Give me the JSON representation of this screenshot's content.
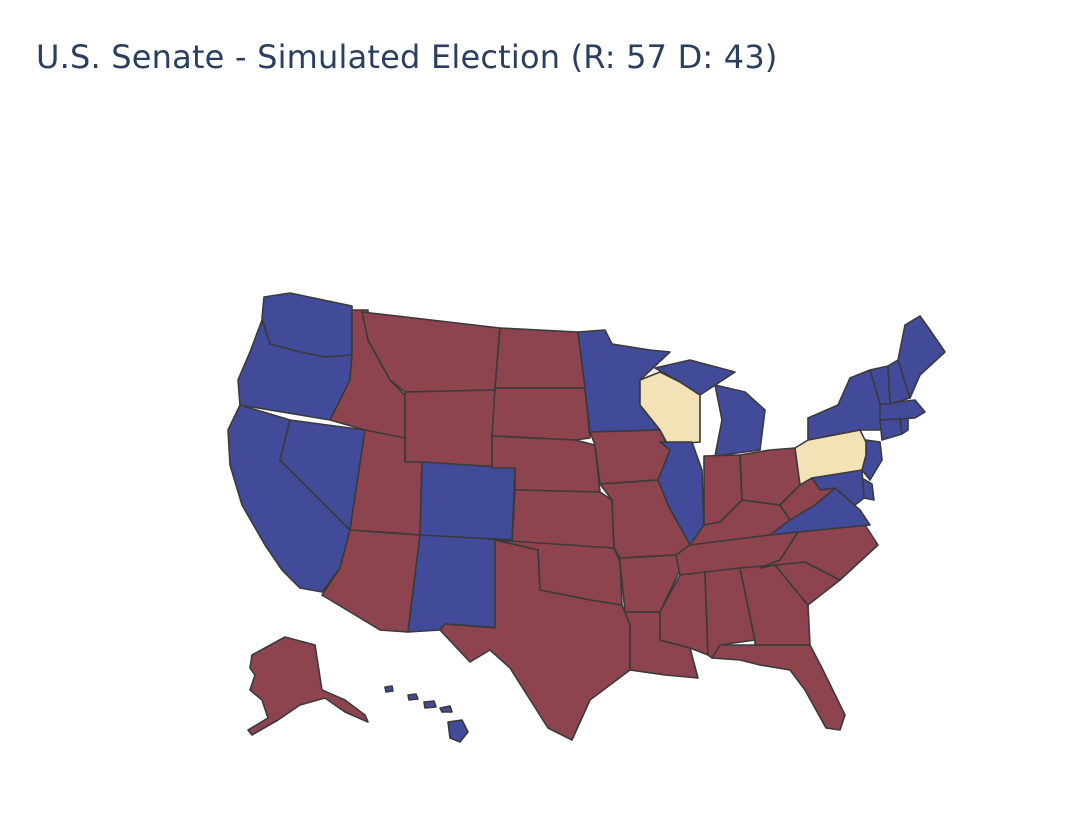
{
  "title": "U.S. Senate - Simulated Election (R: 57 D: 43)",
  "colors": {
    "republican": "#8e444e",
    "democrat": "#414b99",
    "undecided": "#f3e2b5",
    "border": "#3a3a3a",
    "background": "#ffffff"
  },
  "states": {
    "WA": "democrat",
    "OR": "democrat",
    "CA": "democrat",
    "NV": "democrat",
    "ID": "republican",
    "MT": "republican",
    "WY": "republican",
    "UT": "republican",
    "AZ": "republican",
    "CO": "democrat",
    "NM": "democrat",
    "ND": "republican",
    "SD": "republican",
    "NE": "republican",
    "KS": "republican",
    "OK": "republican",
    "TX": "republican",
    "MN": "democrat",
    "IA": "republican",
    "MO": "republican",
    "AR": "republican",
    "LA": "republican",
    "WI": "undecided",
    "IL": "democrat",
    "MI": "democrat",
    "IN": "republican",
    "OH": "republican",
    "KY": "republican",
    "TN": "republican",
    "MS": "republican",
    "AL": "republican",
    "GA": "republican",
    "FL": "republican",
    "SC": "republican",
    "NC": "republican",
    "VA": "democrat",
    "WV": "republican",
    "PA": "undecided",
    "NY": "democrat",
    "VT": "democrat",
    "NH": "democrat",
    "ME": "democrat",
    "MA": "democrat",
    "RI": "democrat",
    "CT": "democrat",
    "NJ": "democrat",
    "DE": "democrat",
    "MD": "democrat",
    "AK": "republican",
    "HI": "democrat"
  }
}
